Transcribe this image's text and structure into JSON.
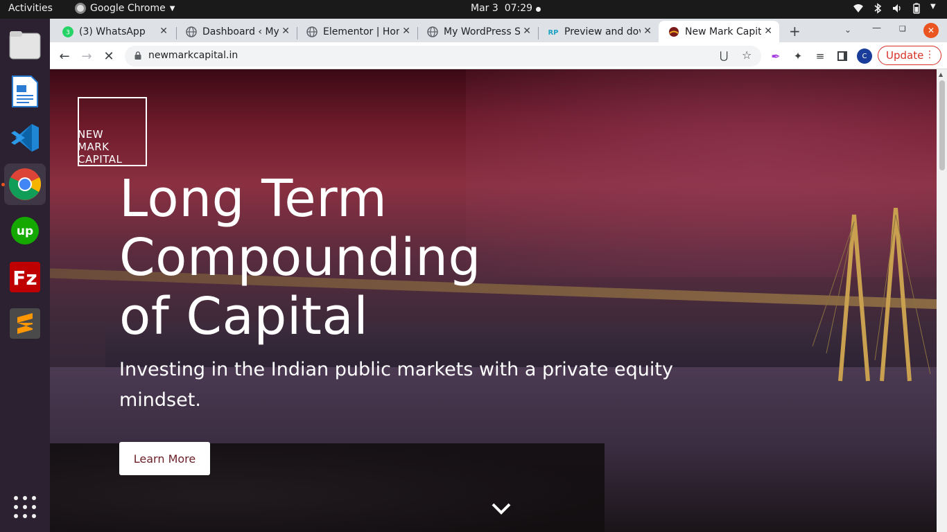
{
  "system": {
    "activities": "Activities",
    "app_name": "Google Chrome",
    "date": "Mar 3",
    "time": "07:29"
  },
  "dock": {
    "apps": [
      "Files",
      "LibreOffice Writer",
      "Visual Studio Code",
      "Google Chrome",
      "Upwork",
      "FileZilla",
      "Sublime Text"
    ],
    "active": "Google Chrome"
  },
  "browser": {
    "tabs": [
      {
        "title": "(3) WhatsApp",
        "icon": "whatsapp-icon"
      },
      {
        "title": "Dashboard ‹ My",
        "icon": "globe-icon"
      },
      {
        "title": "Elementor | Hon",
        "icon": "globe-icon"
      },
      {
        "title": "My WordPress S",
        "icon": "globe-icon"
      },
      {
        "title": "Preview and dov",
        "icon": "rp-icon"
      },
      {
        "title": "New Mark Capit",
        "icon": "newmark-icon",
        "active": true
      }
    ],
    "url": "newmarkcapital.in",
    "update_label": "Update",
    "avatar_letter": "C"
  },
  "page": {
    "logo_lines": [
      "NEW",
      "MARK",
      "CAPITAL"
    ],
    "title_lines": [
      "Long Term",
      "Compounding",
      "of Capital"
    ],
    "subtitle": "Investing in the Indian public markets with a private equity mindset.",
    "cta_label": "Learn More"
  },
  "colors": {
    "brand": "#6a1e26",
    "accent": "#e95420"
  }
}
